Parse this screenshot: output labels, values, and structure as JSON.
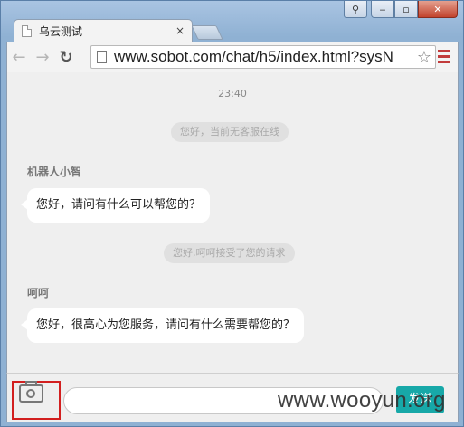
{
  "window": {
    "caption_buttons": [
      "profile",
      "minimize",
      "maximize",
      "close"
    ]
  },
  "tab": {
    "title": "乌云测试",
    "close_symbol": "×"
  },
  "toolbar": {
    "url": "www.sobot.com/chat/h5/index.html?sysN",
    "back_icon": "back-arrow-icon",
    "forward_icon": "forward-arrow-icon",
    "reload_icon": "reload-icon"
  },
  "chat": {
    "time": "23:40",
    "system_messages": [
      "您好，当前无客服在线",
      "您好,呵呵接受了您的请求"
    ],
    "messages": [
      {
        "sender": "机器人小智",
        "text": "您好，请问有什么可以帮您的？"
      },
      {
        "sender": "呵呵",
        "text": "您好，很高心为您服务，请问有什么需要帮您的？"
      }
    ]
  },
  "input": {
    "placeholder": "",
    "value": "",
    "send_label": "发送"
  },
  "watermark": "www.wooyun.org",
  "colors": {
    "accent": "#17a8a8",
    "highlight_box": "#d21f1f",
    "background": "#efefef"
  }
}
